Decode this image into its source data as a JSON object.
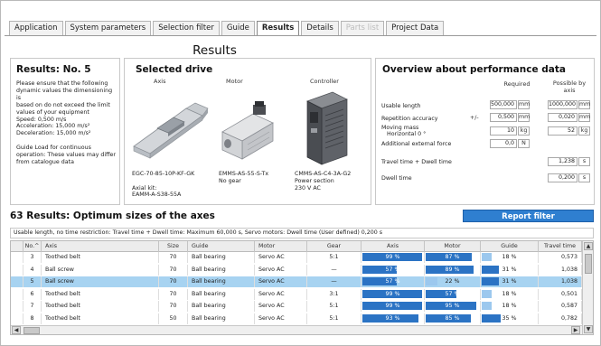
{
  "tabs": [
    {
      "label": "Application",
      "state": "normal"
    },
    {
      "label": "System parameters",
      "state": "normal"
    },
    {
      "label": "Selection filter",
      "state": "normal"
    },
    {
      "label": "Guide",
      "state": "normal"
    },
    {
      "label": "Results",
      "state": "active"
    },
    {
      "label": "Details",
      "state": "normal"
    },
    {
      "label": "Parts list",
      "state": "disabled"
    },
    {
      "label": "Project Data",
      "state": "normal"
    }
  ],
  "page_title": "Results",
  "results_panel": {
    "heading": "Results: No. 5",
    "lines": [
      "Please ensure that the following",
      "dynamic values the dimensioning is",
      "based on do not exceed the limit",
      "values of your equipment",
      "Speed: 0,500 m/s",
      "Acceleration: 15,000 m/s²",
      "Deceleration: 15,000 m/s²",
      "",
      "Guide Load for continuous",
      "operation: These values may differ",
      "from catalogue data"
    ]
  },
  "drive_panel": {
    "heading": "Selected drive",
    "axis": {
      "label": "Axis",
      "line1": "EGC-70-85-10P-KF-GK",
      "line2": "",
      "line3": "Axial kit:",
      "line4": "EAMM-A-S38-55A"
    },
    "motor": {
      "label": "Motor",
      "line1": "EMMS-AS-55-S-Tx",
      "line2": "No gear"
    },
    "controller": {
      "label": "Controller",
      "line1": "CMMS-AS-C4-3A-G2",
      "line2": "Power section",
      "line3": "230 V AC"
    }
  },
  "perf_panel": {
    "heading": "Overview about performance data",
    "col_required": "Required",
    "col_possible": "Possible by axis",
    "rows": [
      {
        "label": "Usable length",
        "required": "500,000",
        "unit": "mm",
        "possible": "1000,000",
        "punit": "mm"
      },
      {
        "label": "Repetition accuracy",
        "pm": "+/-",
        "required": "0,500",
        "unit": "mm",
        "possible": "0,020",
        "punit": "mm"
      },
      {
        "label": "Moving mass",
        "label2": "Horizontal 0 °",
        "required": "10",
        "unit": "kg",
        "possible": "52",
        "punit": "kg"
      },
      {
        "label": "Additional external force",
        "required": "0,0",
        "unit": "N"
      }
    ],
    "travel_label": "Travel time + Dwell time",
    "travel_value": "1,238",
    "travel_unit": "s",
    "dwell_label": "Dwell time",
    "dwell_value": "0,200",
    "dwell_unit": "s"
  },
  "results_title": "63 Results: Optimum sizes of the axes",
  "report_button": "Report filter",
  "info_line": "Usable length, no time restriction: Travel time + Dwell time: Maximum 60,000 s, Servo motors: Dwell time (User defined) 0,200 s",
  "table": {
    "headers": [
      "No.^",
      "Axis",
      "Size",
      "Guide",
      "Motor",
      "Gear",
      "Axis",
      "Motor",
      "Guide",
      "Travel time"
    ],
    "rows": [
      {
        "no": "3",
        "axis": "Toothed belt",
        "size": "70",
        "guide": "Ball bearing",
        "motor": "Servo AC",
        "gear": "5:1",
        "axis_pct": "99 %",
        "axis_frac": 0.99,
        "motor_pct": "87 %",
        "motor_frac": 0.87,
        "guide_pct": "18 %",
        "guide_frac": 0.18,
        "time": "0,573",
        "selected": false
      },
      {
        "no": "4",
        "axis": "Ball screw",
        "size": "70",
        "guide": "Ball bearing",
        "motor": "Servo AC",
        "gear": "—",
        "axis_pct": "57 %",
        "axis_frac": 0.57,
        "motor_pct": "89 %",
        "motor_frac": 0.89,
        "guide_pct": "31 %",
        "guide_frac": 0.31,
        "time": "1,038",
        "selected": false
      },
      {
        "no": "5",
        "axis": "Ball screw",
        "size": "70",
        "guide": "Ball bearing",
        "motor": "Servo AC",
        "gear": "—",
        "axis_pct": "57 %",
        "axis_frac": 0.57,
        "motor_pct": "22 %",
        "motor_frac": 0.22,
        "guide_pct": "31 %",
        "guide_frac": 0.31,
        "time": "1,038",
        "selected": true
      },
      {
        "no": "6",
        "axis": "Toothed belt",
        "size": "70",
        "guide": "Ball bearing",
        "motor": "Servo AC",
        "gear": "3:1",
        "axis_pct": "99 %",
        "axis_frac": 0.99,
        "motor_pct": "57 %",
        "motor_frac": 0.57,
        "guide_pct": "18 %",
        "guide_frac": 0.18,
        "time": "0,501",
        "selected": false
      },
      {
        "no": "7",
        "axis": "Toothed belt",
        "size": "70",
        "guide": "Ball bearing",
        "motor": "Servo AC",
        "gear": "5:1",
        "axis_pct": "99 %",
        "axis_frac": 0.99,
        "motor_pct": "95 %",
        "motor_frac": 0.95,
        "guide_pct": "18 %",
        "guide_frac": 0.18,
        "time": "0,587",
        "selected": false
      },
      {
        "no": "8",
        "axis": "Toothed belt",
        "size": "50",
        "guide": "Ball bearing",
        "motor": "Servo AC",
        "gear": "5:1",
        "axis_pct": "93 %",
        "axis_frac": 0.93,
        "motor_pct": "85 %",
        "motor_frac": 0.85,
        "guide_pct": "35 %",
        "guide_frac": 0.35,
        "time": "0,782",
        "selected": false
      }
    ]
  },
  "colors": {
    "bar_dark": "#2b73c4",
    "bar_light": "#9cc8ee",
    "selected_row": "#a7d3f1",
    "report_button": "#2f7fd0"
  }
}
